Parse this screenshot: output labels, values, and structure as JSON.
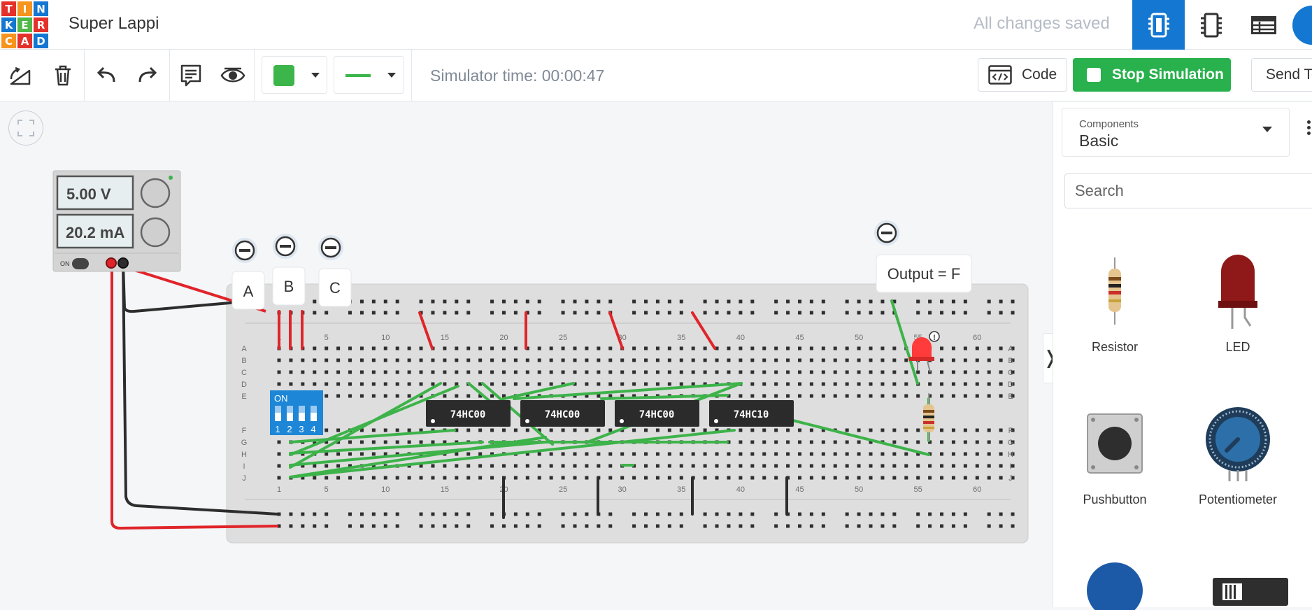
{
  "app": {
    "logo_letters": [
      "T",
      "I",
      "N",
      "K",
      "E",
      "R",
      "C",
      "A",
      "D"
    ],
    "project_title": "Super Lappi",
    "save_status": "All changes saved"
  },
  "toolbar": {
    "fill_color": "#3cb54a",
    "simulator_time": "Simulator time: 00:00:47",
    "code_label": "Code",
    "stop_label": "Stop Simulation",
    "send_label": "Send To"
  },
  "circuit": {
    "power_supply": {
      "voltage": "5.00 V",
      "current": "20.2 mA",
      "on_label": "ON"
    },
    "dip_switch_on_label": "ON",
    "dip_switch_numbers": [
      "1",
      "2",
      "3",
      "4"
    ],
    "input_labels": [
      "A",
      "B",
      "C"
    ],
    "output_label": "Output = F",
    "chips": [
      "74HC00",
      "74HC00",
      "74HC00",
      "74HC10"
    ],
    "row_labels_top": [
      "A",
      "B",
      "C",
      "D",
      "E"
    ],
    "row_labels_bottom": [
      "F",
      "G",
      "H",
      "I",
      "J"
    ],
    "column_numbers": [
      "1",
      "5",
      "10",
      "15",
      "20",
      "25",
      "30",
      "35",
      "40",
      "45",
      "50",
      "55",
      "60"
    ],
    "warning_symbol": "!"
  },
  "panel": {
    "components_label": "Components",
    "components_value": "Basic",
    "search_placeholder": "Search",
    "items": [
      {
        "label": "Resistor"
      },
      {
        "label": "LED"
      },
      {
        "label": "Pushbutton"
      },
      {
        "label": "Potentiometer"
      }
    ],
    "toggle_glyph": "❭"
  },
  "colors": {
    "brand_blue": "#1477d1",
    "sim_green": "#28b14c",
    "wire_red": "#e0252a",
    "wire_black": "#2d2d2d",
    "wire_green": "#3db34a"
  }
}
